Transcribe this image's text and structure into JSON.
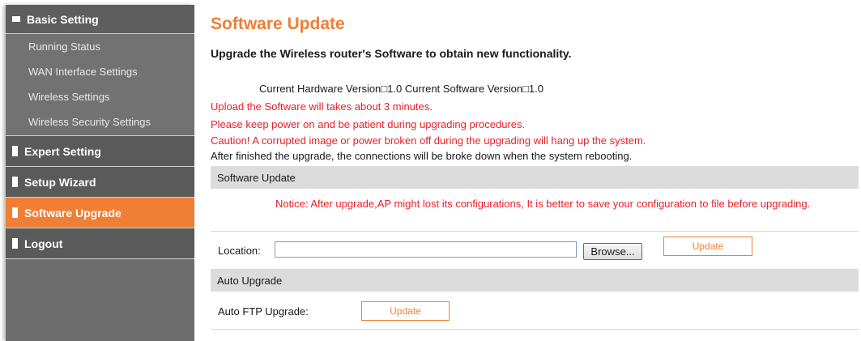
{
  "sidebar": {
    "basic_setting": "Basic Setting",
    "basic_items": [
      "Running Status",
      "WAN Interface Settings",
      "Wireless Settings",
      "Wireless Security Settings"
    ],
    "expert_setting": "Expert Setting",
    "setup_wizard": "Setup Wizard",
    "software_upgrade": "Software Upgrade",
    "logout": "Logout"
  },
  "main": {
    "title": "Software Update",
    "subtitle": "Upgrade the Wireless router's Software to obtain new functionality.",
    "version_line": "Current Hardware Version□1.0  Current Software Version□1.0",
    "warnings": [
      "Upload the Software will takes about 3 minutes.",
      "Please keep power on and be patient during upgrading procedures.",
      "Caution! A corrupted image or power broken off during the upgrading will hang up the system."
    ],
    "info": "After finished the upgrade, the connections will be broke down when the system rebooting.",
    "software_update_section": "Software Update",
    "notice": "Notice: After upgrade,AP might lost its configurations, It is better to save your configuration to file before upgrading.",
    "location_label": "Location:",
    "location_value": "",
    "browse_label": "Browse...",
    "update_label": "Update",
    "auto_upgrade_section": "Auto Upgrade",
    "auto_ftp_label": "Auto FTP Upgrade:",
    "auto_update_label": "Update"
  },
  "colors": {
    "accent": "#ef7f36",
    "warning": "#e8202a",
    "sidebar": "#6e6e6e"
  }
}
